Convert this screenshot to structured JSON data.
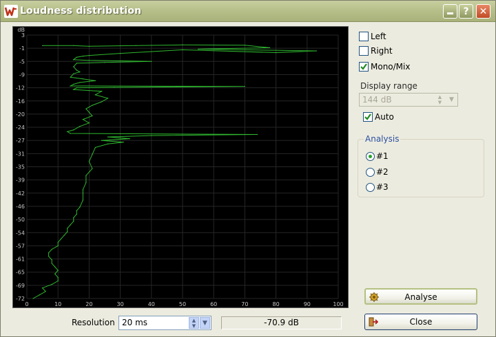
{
  "window": {
    "title": "Loudness distribution",
    "buttons": {
      "help": "?",
      "close": "✕"
    }
  },
  "channels": {
    "left": {
      "label": "Left",
      "checked": false
    },
    "right": {
      "label": "Right",
      "checked": false
    },
    "mono": {
      "label": "Mono/Mix",
      "checked": true
    }
  },
  "display_range": {
    "label": "Display range",
    "value": "144 dB",
    "auto_label": "Auto",
    "auto_checked": true
  },
  "analysis": {
    "title": "Analysis",
    "options": [
      "#1",
      "#2",
      "#3"
    ],
    "selected": "#1"
  },
  "buttons": {
    "analyse": "Analyse",
    "close": "Close"
  },
  "resolution": {
    "label": "Resolution",
    "value": "20 ms"
  },
  "readout": "-70.9 dB",
  "colors": {
    "trace": "#33cc33",
    "grid": "#262626",
    "background": "#000000"
  },
  "icons": [
    "app-logo-icon",
    "minimize-icon",
    "help-icon",
    "close-icon",
    "gear-icon",
    "exit-icon",
    "checkmark-icon"
  ],
  "chart_data": {
    "type": "line",
    "title": "",
    "xlabel": "",
    "ylabel": "dB",
    "x_ticks": [
      "0",
      "10",
      "20",
      "30",
      "40",
      "50",
      "60",
      "70",
      "80",
      "90",
      "100"
    ],
    "y_ticks": [
      "3",
      "-1",
      "-5",
      "-9",
      "-12",
      "-16",
      "-20",
      "-24",
      "-27",
      "-31",
      "-35",
      "-39",
      "-42",
      "-46",
      "-50",
      "-54",
      "-57",
      "-61",
      "-65",
      "-69",
      "-72"
    ],
    "xlim": [
      0,
      100
    ],
    "ylim": [
      -72,
      3
    ],
    "grid": true,
    "series": [
      {
        "points": [
          [
            5,
            0
          ],
          [
            15,
            0
          ],
          [
            20,
            -0.2
          ],
          [
            35,
            0
          ],
          [
            50,
            0.2
          ],
          [
            70,
            0.1
          ],
          [
            78,
            -0.6
          ],
          [
            55,
            -1.0
          ],
          [
            93,
            -1.5
          ],
          [
            80,
            -2.0
          ],
          [
            50,
            -1.2
          ],
          [
            30,
            -2.2
          ],
          [
            20,
            -2.8
          ],
          [
            18,
            -3.0
          ],
          [
            16,
            -3.3
          ],
          [
            15,
            -4
          ],
          [
            20,
            -4.2
          ],
          [
            40,
            -4.5
          ],
          [
            25,
            -4.8
          ],
          [
            16,
            -5.0
          ],
          [
            15,
            -6
          ],
          [
            16,
            -7
          ],
          [
            17,
            -7.5
          ],
          [
            15,
            -8
          ],
          [
            14,
            -9
          ],
          [
            18,
            -9.5
          ],
          [
            22,
            -10
          ],
          [
            17,
            -10.5
          ],
          [
            15,
            -11
          ],
          [
            14,
            -11.5
          ],
          [
            70,
            -11.6
          ],
          [
            28,
            -11.9
          ],
          [
            16,
            -12
          ],
          [
            15,
            -12.5
          ],
          [
            24,
            -13
          ],
          [
            22,
            -14
          ],
          [
            26,
            -15
          ],
          [
            24,
            -16
          ],
          [
            21,
            -17
          ],
          [
            19,
            -18
          ],
          [
            20,
            -19
          ],
          [
            21,
            -20
          ],
          [
            18,
            -21
          ],
          [
            20,
            -22
          ],
          [
            17,
            -23
          ],
          [
            15,
            -24
          ],
          [
            13,
            -24.5
          ],
          [
            14,
            -25
          ],
          [
            74,
            -25.3
          ],
          [
            40,
            -25.6
          ],
          [
            26,
            -26
          ],
          [
            33,
            -26.5
          ],
          [
            24,
            -27
          ],
          [
            31,
            -27.5
          ],
          [
            26,
            -28
          ],
          [
            22,
            -29
          ],
          [
            21,
            -31
          ],
          [
            20,
            -33
          ],
          [
            21,
            -35
          ],
          [
            19,
            -37
          ],
          [
            19,
            -39
          ],
          [
            18,
            -41
          ],
          [
            18,
            -42
          ],
          [
            18,
            -44
          ],
          [
            17,
            -46
          ],
          [
            16,
            -47
          ],
          [
            16,
            -48
          ],
          [
            15,
            -49
          ],
          [
            15,
            -50
          ],
          [
            14,
            -51
          ],
          [
            13,
            -52
          ],
          [
            13,
            -53
          ],
          [
            12,
            -54
          ],
          [
            11,
            -55
          ],
          [
            10,
            -56
          ],
          [
            10,
            -57
          ],
          [
            8,
            -58
          ],
          [
            7,
            -59
          ],
          [
            7,
            -60
          ],
          [
            8,
            -61
          ],
          [
            8,
            -62
          ],
          [
            9,
            -63
          ],
          [
            10,
            -64
          ],
          [
            9,
            -65
          ],
          [
            10,
            -66
          ],
          [
            10,
            -67
          ],
          [
            8,
            -68
          ],
          [
            5,
            -69
          ],
          [
            6,
            -70
          ],
          [
            4,
            -71
          ],
          [
            2,
            -72
          ]
        ]
      }
    ]
  }
}
